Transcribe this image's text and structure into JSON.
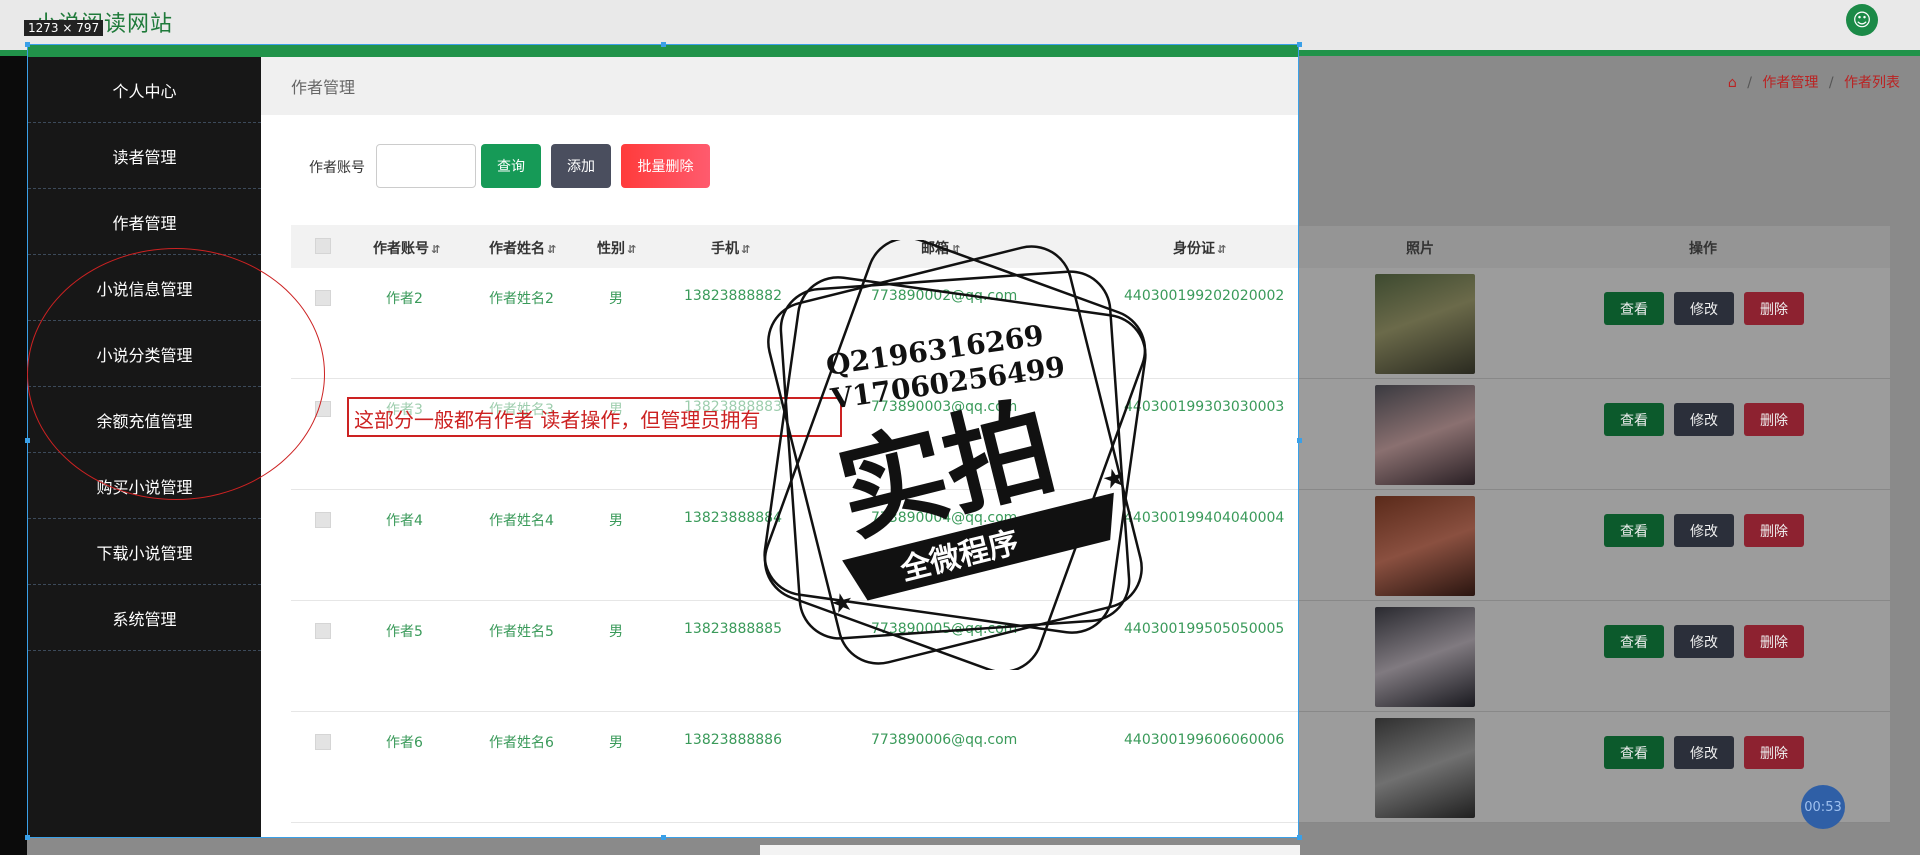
{
  "app": {
    "title": "小说阅读网站"
  },
  "selection": {
    "size_label": "1273 × 797"
  },
  "sidebar": {
    "items": [
      {
        "label": "个人中心"
      },
      {
        "label": "读者管理"
      },
      {
        "label": "作者管理"
      },
      {
        "label": "小说信息管理"
      },
      {
        "label": "小说分类管理"
      },
      {
        "label": "余额充值管理"
      },
      {
        "label": "购买小说管理"
      },
      {
        "label": "下载小说管理"
      },
      {
        "label": "系统管理"
      }
    ]
  },
  "page": {
    "title": "作者管理"
  },
  "breadcrumb": {
    "items": [
      "作者管理",
      "作者列表"
    ]
  },
  "search": {
    "label": "作者账号",
    "value": "",
    "placeholder": ""
  },
  "toolbar": {
    "query": "查询",
    "add": "添加",
    "batch_delete": "批量删除"
  },
  "table": {
    "columns": [
      "作者账号",
      "作者姓名",
      "性别",
      "手机",
      "邮箱",
      "身份证",
      "照片",
      "操作"
    ],
    "rows": [
      {
        "account": "作者2",
        "name": "作者姓名2",
        "gender": "男",
        "phone": "13823888882",
        "email": "773890002@qq.com",
        "id_card": "440300199202020002"
      },
      {
        "account": "作者3",
        "name": "作者姓名3",
        "gender": "男",
        "phone": "13823888883",
        "email": "773890003@qq.com",
        "id_card": "440300199303030003"
      },
      {
        "account": "作者4",
        "name": "作者姓名4",
        "gender": "男",
        "phone": "13823888884",
        "email": "773890004@qq.com",
        "id_card": "440300199404040004"
      },
      {
        "account": "作者5",
        "name": "作者姓名5",
        "gender": "男",
        "phone": "13823888885",
        "email": "773890005@qq.com",
        "id_card": "440300199505050005"
      },
      {
        "account": "作者6",
        "name": "作者姓名6",
        "gender": "男",
        "phone": "13823888886",
        "email": "773890006@qq.com",
        "id_card": "440300199606060006"
      }
    ],
    "actions": {
      "view": "查看",
      "edit": "修改",
      "delete": "删除"
    }
  },
  "annotation": {
    "text": "这部分一般都有作者 读者操作，但管理员拥有"
  },
  "watermark": {
    "line1": "Q2196316269",
    "line2": "V17060256499",
    "big": "实拍",
    "banner": "全微程序"
  },
  "timer": {
    "value": "00:53"
  },
  "colors": {
    "accent": "#21934a",
    "sidebar": "#171717",
    "link_text": "#3a9a5a",
    "danger": "#ff3b3b"
  }
}
